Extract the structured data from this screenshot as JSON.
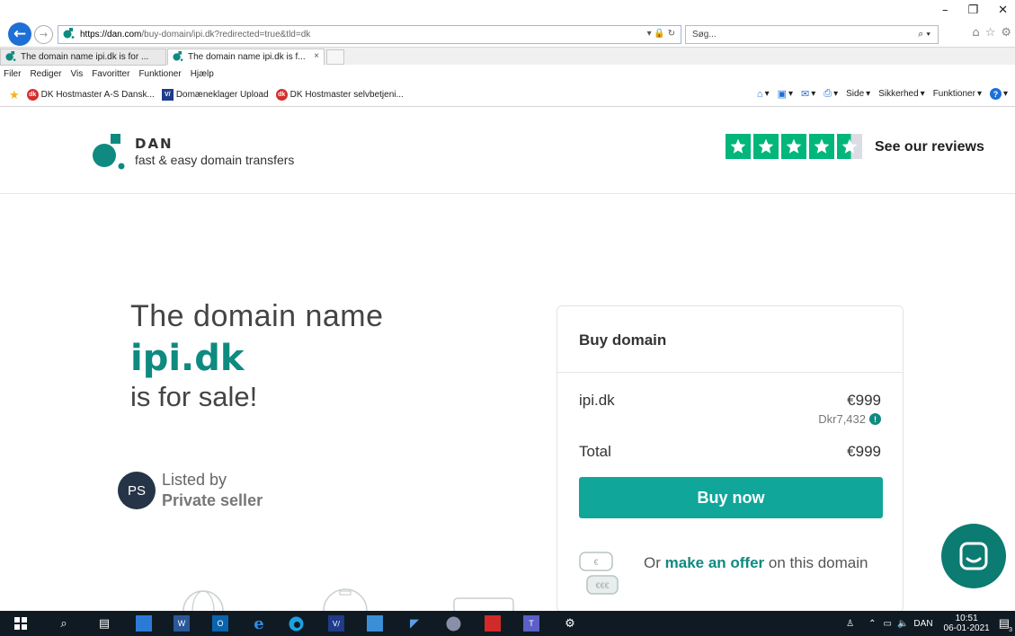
{
  "browser": {
    "address": {
      "url_host": "https://dan.com",
      "url_path": "/buy-domain/ipi.dk?redirected=true&tld=dk"
    },
    "search_placeholder": "Søg...",
    "tabs": [
      {
        "label": "The domain name ipi.dk is for ..."
      },
      {
        "label": "The domain name ipi.dk is f..."
      }
    ],
    "menu": [
      "Filer",
      "Rediger",
      "Vis",
      "Favoritter",
      "Funktioner",
      "Hjælp"
    ],
    "favorites": [
      {
        "label": "DK Hostmaster A-S Dansk...",
        "badge": "dk"
      },
      {
        "label": "Domæneklager Upload",
        "badge": "V/"
      },
      {
        "label": "DK Hostmaster selvbetjeni...",
        "badge": "dk"
      }
    ],
    "commands": {
      "page": "Side",
      "security": "Sikkerhed",
      "tools": "Funktioner"
    }
  },
  "site": {
    "brand_name": "DAN",
    "tagline": "fast & easy domain transfers",
    "reviews_label": "See our reviews",
    "rating_stars": 4.5
  },
  "hero": {
    "line1": "The domain name",
    "domain": "ipi.dk",
    "line3": "is for sale!"
  },
  "seller": {
    "initials": "PS",
    "listed_by": "Listed by",
    "name": "Private seller"
  },
  "card": {
    "title": "Buy domain",
    "domain": "ipi.dk",
    "price": "€999",
    "price_local": "Dkr7,432",
    "info_mark": "!",
    "total_label": "Total",
    "total": "€999",
    "buy_label": "Buy now",
    "offer_prefix": "Or",
    "offer_link": "make an offer",
    "offer_suffix": "on this domain",
    "offer_icon_symbols": {
      "top": "€",
      "bottom": "€€€"
    }
  },
  "taskbar": {
    "language": "DAN",
    "time": "10:51",
    "date": "06-01-2021",
    "notification_count": "3"
  },
  "colors": {
    "brand_teal": "#0f8a80",
    "button_teal": "#10a69a",
    "trustpilot_green": "#00b67a",
    "avatar_bg": "#253447",
    "taskbar": "#101a22"
  }
}
